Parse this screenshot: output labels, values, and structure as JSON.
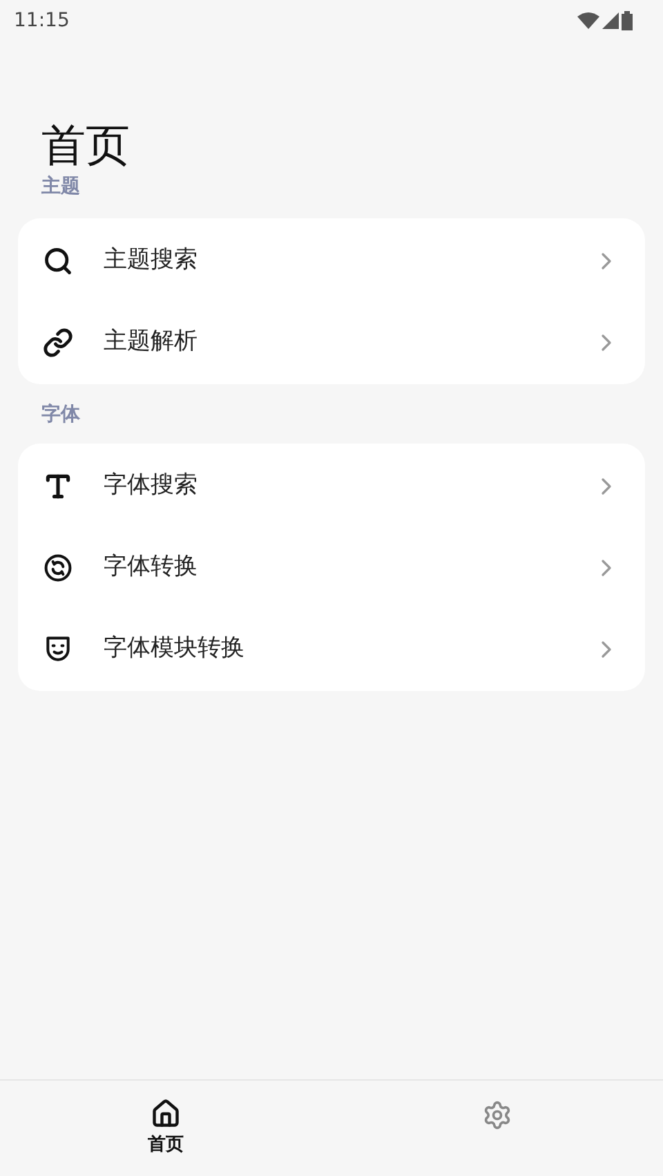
{
  "status_bar": {
    "time": "11:15"
  },
  "title": "首页",
  "sections": [
    {
      "heading": "主题",
      "items": [
        {
          "label": "主题搜索"
        },
        {
          "label": "主题解析"
        }
      ]
    },
    {
      "heading": "字体",
      "items": [
        {
          "label": "字体搜索"
        },
        {
          "label": "字体转换"
        },
        {
          "label": "字体模块转换"
        }
      ]
    }
  ],
  "bottom_nav": [
    {
      "label": "首页",
      "selected": true
    },
    {
      "selected": false
    }
  ]
}
